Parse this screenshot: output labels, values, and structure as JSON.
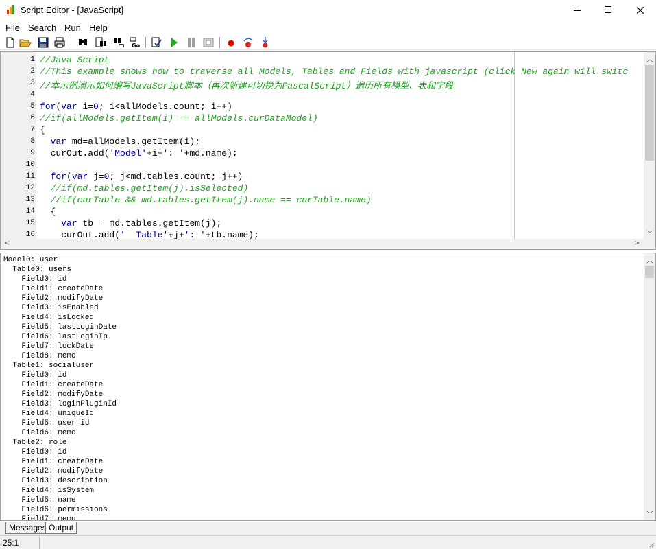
{
  "window": {
    "title": "Script Editor - [JavaScript]"
  },
  "menu": [
    {
      "label": "File",
      "ul": "F",
      "rest": "ile"
    },
    {
      "label": "Search",
      "ul": "S",
      "rest": "earch"
    },
    {
      "label": "Run",
      "ul": "R",
      "rest": "un"
    },
    {
      "label": "Help",
      "ul": "H",
      "rest": "elp"
    }
  ],
  "toolbar_icons": [
    "new-file-icon",
    "open-folder-icon",
    "save-icon",
    "print-icon",
    "find-icon",
    "find-next-icon",
    "replace-icon",
    "goto-line-icon",
    "compile-icon",
    "run-icon",
    "pause-icon",
    "stop-icon",
    "breakpoint-icon",
    "step-over-icon",
    "step-into-icon"
  ],
  "editor": {
    "lines": [
      {
        "n": "1",
        "parts": [
          [
            "c",
            "//Java Script"
          ]
        ]
      },
      {
        "n": "2",
        "parts": [
          [
            "c",
            "//This example shows how to traverse all Models, Tables and Fields with javascript (click New again will switc"
          ]
        ]
      },
      {
        "n": "3",
        "parts": [
          [
            "c",
            "//本示例演示如何编写JavaScript脚本（再次新建可切换为PascalScript）遍历所有模型、表和字段"
          ]
        ]
      },
      {
        "n": "4",
        "parts": []
      },
      {
        "n": "5",
        "parts": [
          [
            "k",
            "for"
          ],
          [
            "p",
            "("
          ],
          [
            "k",
            "var"
          ],
          [
            "p",
            " i="
          ],
          [
            "s",
            "0"
          ],
          [
            "p",
            "; i<allModels.count; i++)"
          ]
        ]
      },
      {
        "n": "6",
        "parts": [
          [
            "c",
            "//if(allModels.getItem(i) == allModels.curDataModel)"
          ]
        ]
      },
      {
        "n": "7",
        "parts": [
          [
            "p",
            "{"
          ]
        ]
      },
      {
        "n": "8",
        "parts": [
          [
            "p",
            "  "
          ],
          [
            "k",
            "var"
          ],
          [
            "p",
            " md=allModels.getItem(i);"
          ]
        ]
      },
      {
        "n": "9",
        "parts": [
          [
            "p",
            "  curOut.add("
          ],
          [
            "s",
            "'Model'"
          ],
          [
            "p",
            "+i+"
          ],
          [
            "s",
            "': '"
          ],
          [
            "p",
            "+md.name);"
          ]
        ]
      },
      {
        "n": "10",
        "parts": []
      },
      {
        "n": "11",
        "parts": [
          [
            "p",
            "  "
          ],
          [
            "k",
            "for"
          ],
          [
            "p",
            "("
          ],
          [
            "k",
            "var"
          ],
          [
            "p",
            " j="
          ],
          [
            "s",
            "0"
          ],
          [
            "p",
            "; j<md.tables.count; j++)"
          ]
        ]
      },
      {
        "n": "12",
        "parts": [
          [
            "p",
            "  "
          ],
          [
            "c",
            "//if(md.tables.getItem(j).isSelected)"
          ]
        ]
      },
      {
        "n": "13",
        "parts": [
          [
            "p",
            "  "
          ],
          [
            "c",
            "//if(curTable && md.tables.getItem(j).name == curTable.name)"
          ]
        ]
      },
      {
        "n": "14",
        "parts": [
          [
            "p",
            "  {"
          ]
        ]
      },
      {
        "n": "15",
        "parts": [
          [
            "p",
            "    "
          ],
          [
            "k",
            "var"
          ],
          [
            "p",
            " tb = md.tables.getItem(j);"
          ]
        ]
      },
      {
        "n": "16",
        "parts": [
          [
            "p",
            "    curOut.add("
          ],
          [
            "s",
            "'  Table'"
          ],
          [
            "p",
            "+j+"
          ],
          [
            "s",
            "': '"
          ],
          [
            "p",
            "+tb.name);"
          ]
        ]
      }
    ]
  },
  "output": {
    "lines": [
      "Model0: user",
      "  Table0: users",
      "    Field0: id",
      "    Field1: createDate",
      "    Field2: modifyDate",
      "    Field3: isEnabled",
      "    Field4: isLocked",
      "    Field5: lastLoginDate",
      "    Field6: lastLoginIp",
      "    Field7: lockDate",
      "    Field8: memo",
      "  Table1: socialuser",
      "    Field0: id",
      "    Field1: createDate",
      "    Field2: modifyDate",
      "    Field3: loginPluginId",
      "    Field4: uniqueId",
      "    Field5: user_id",
      "    Field6: memo",
      "  Table2: role",
      "    Field0: id",
      "    Field1: createDate",
      "    Field2: modifyDate",
      "    Field3: description",
      "    Field4: isSystem",
      "    Field5: name",
      "    Field6: permissions",
      "    Field7: memo"
    ]
  },
  "tabs": {
    "messages": "Messages",
    "output": "Output"
  },
  "status": {
    "position": "25:1"
  },
  "colors": {
    "comment": "#20a020",
    "keyword": "#0000a0",
    "breakpoint": "#e00000",
    "run": "#2aa52a"
  }
}
